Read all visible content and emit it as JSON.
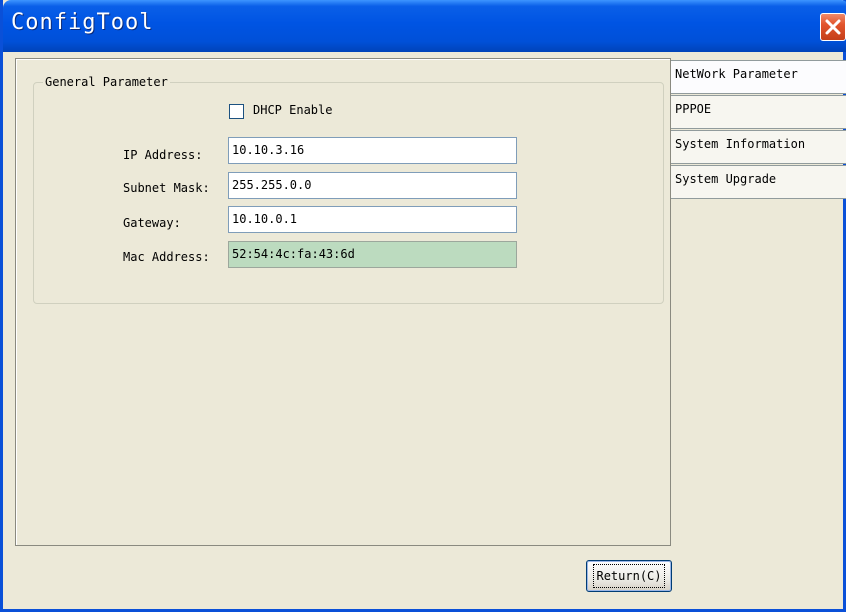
{
  "window": {
    "title": "ConfigTool"
  },
  "group": {
    "legend": "General Parameter",
    "dhcp_label": "DHCP Enable",
    "dhcp_checked": false
  },
  "fields": {
    "ip_label": "IP Address:",
    "ip_value": "10.10.3.16",
    "subnet_label": "Subnet Mask:",
    "subnet_value": "255.255.0.0",
    "gateway_label": "Gateway:",
    "gateway_value": "10.10.0.1",
    "mac_label": "Mac Address:",
    "mac_value": "52:54:4c:fa:43:6d"
  },
  "tabs": [
    {
      "label": "NetWork Parameter",
      "active": true
    },
    {
      "label": "PPPOE",
      "active": false
    },
    {
      "label": "System Information",
      "active": false
    },
    {
      "label": "System Upgrade",
      "active": false
    }
  ],
  "buttons": {
    "return_label": "Return(C)"
  },
  "colors": {
    "titlebar": "#0054e3",
    "close_button": "#e2542c",
    "mac_field_bg": "#bcdbbf"
  }
}
